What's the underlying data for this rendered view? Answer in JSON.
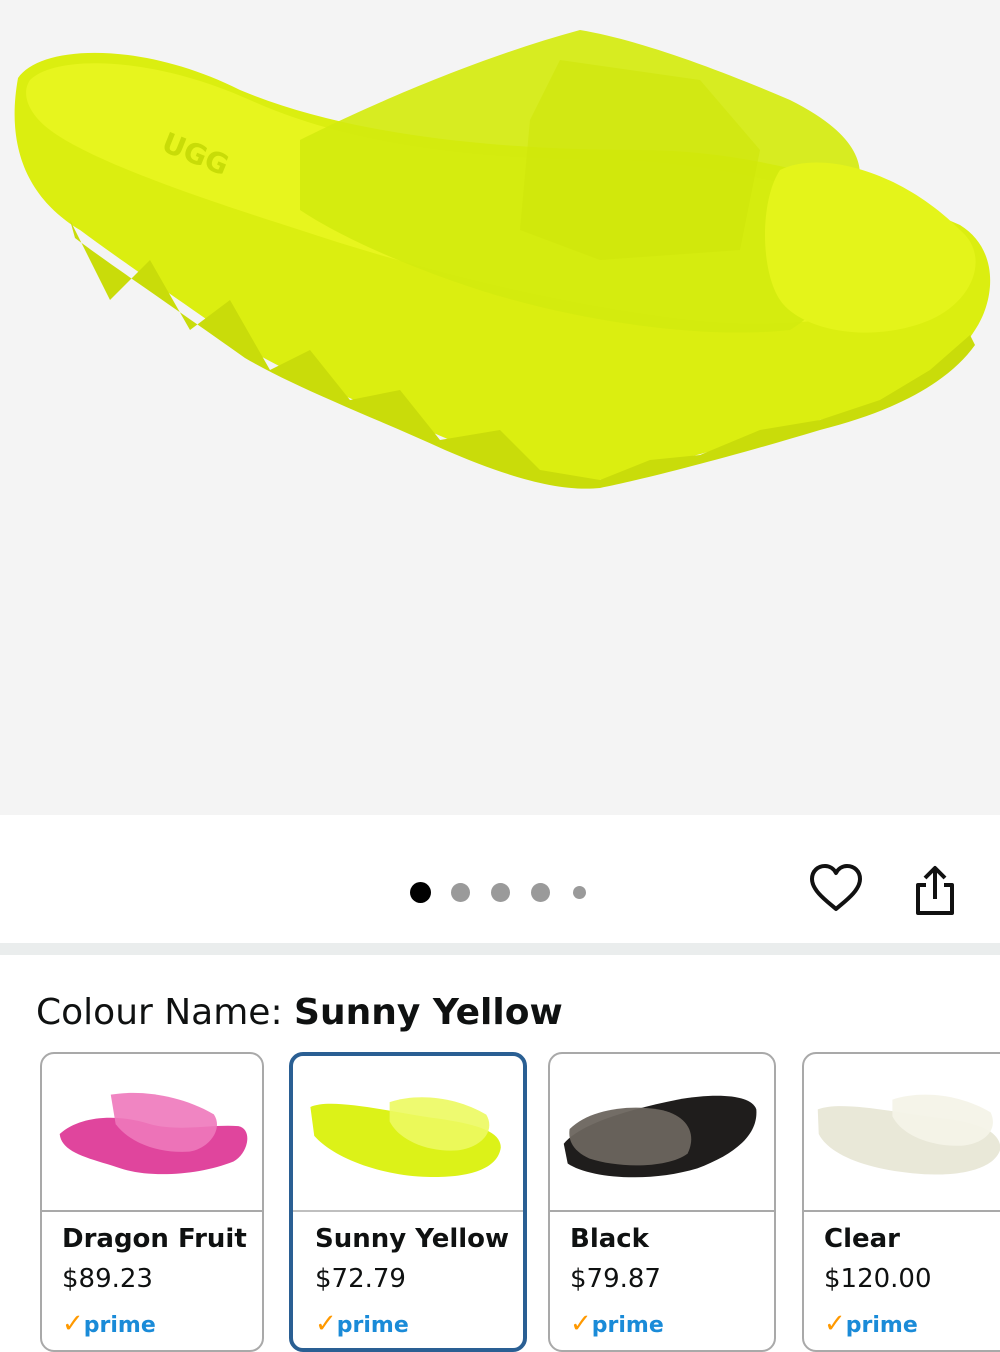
{
  "product": {
    "image_alt": "Neon yellow platform slide sandal",
    "colors": {
      "accent_selected": "#2a5f93",
      "prime": "#1a8bd8",
      "prime_check": "#ff9900"
    }
  },
  "carousel": {
    "dot_count": 5,
    "active_index": 0
  },
  "actions": {
    "wishlist_icon": "heart-icon",
    "share_icon": "share-icon"
  },
  "colour": {
    "label": "Colour Name: ",
    "value": "Sunny Yellow"
  },
  "swatches": [
    {
      "name": "Dragon Fruit",
      "price": "$89.23",
      "prime": "prime",
      "color": "#e0459d",
      "selected": false
    },
    {
      "name": "Sunny Yellow",
      "price": "$72.79",
      "prime": "prime",
      "color": "#dcf218",
      "selected": true
    },
    {
      "name": "Black",
      "price": "$79.87",
      "prime": "prime",
      "color": "#4b4642",
      "selected": false
    },
    {
      "name": "Clear",
      "price": "$120.00",
      "prime": "prime",
      "color": "#e9e8d8",
      "selected": false
    }
  ]
}
